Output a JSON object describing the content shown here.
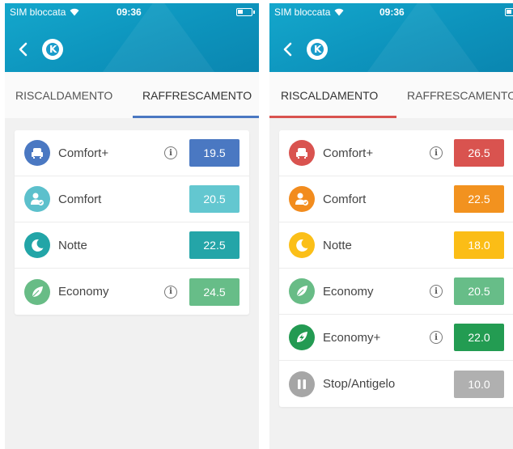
{
  "status": {
    "carrier": "SIM bloccata",
    "time": "09:36"
  },
  "tabs": {
    "heating": "RISCALDAMENTO",
    "cooling": "RAFFRESCAMENTO"
  },
  "colors": {
    "header": "#0f98c2",
    "left_active_tab_underline": "#4a78c2",
    "right_active_tab_underline": "#d9534f"
  },
  "left_panel": {
    "active_tab": "cooling",
    "rows": [
      {
        "label": "Comfort+",
        "value": "19.5",
        "icon": "armchair-icon",
        "icon_color": "#4a78c2",
        "value_color": "#4a78c2",
        "info": true
      },
      {
        "label": "Comfort",
        "value": "20.5",
        "icon": "person-check-icon",
        "icon_color": "#5cc0cc",
        "value_color": "#63c7d0",
        "info": false
      },
      {
        "label": "Notte",
        "value": "22.5",
        "icon": "moon-icon",
        "icon_color": "#22a5a7",
        "value_color": "#24a5a8",
        "info": false
      },
      {
        "label": "Economy",
        "value": "24.5",
        "icon": "leaf-icon",
        "icon_color": "#68bc86",
        "value_color": "#67bd88",
        "info": true
      }
    ]
  },
  "right_panel": {
    "active_tab": "heating",
    "rows": [
      {
        "label": "Comfort+",
        "value": "26.5",
        "icon": "armchair-icon",
        "icon_color": "#d9534f",
        "value_color": "#d9534f",
        "info": true
      },
      {
        "label": "Comfort",
        "value": "22.5",
        "icon": "person-check-icon",
        "icon_color": "#f28c1e",
        "value_color": "#f2921f",
        "info": false
      },
      {
        "label": "Notte",
        "value": "18.0",
        "icon": "moon-icon",
        "icon_color": "#fbbf18",
        "value_color": "#fbbd16",
        "info": false
      },
      {
        "label": "Economy",
        "value": "20.5",
        "icon": "leaf-icon",
        "icon_color": "#68bc86",
        "value_color": "#67bd88",
        "info": true
      },
      {
        "label": "Economy+",
        "value": "22.0",
        "icon": "leaf-bolt-icon",
        "icon_color": "#239a52",
        "value_color": "#239c52",
        "info": true
      },
      {
        "label": "Stop/Antigelo",
        "value": "10.0",
        "icon": "pause-icon",
        "icon_color": "#a6a6a6",
        "value_color": "#b0b0b0",
        "info": false
      }
    ]
  }
}
